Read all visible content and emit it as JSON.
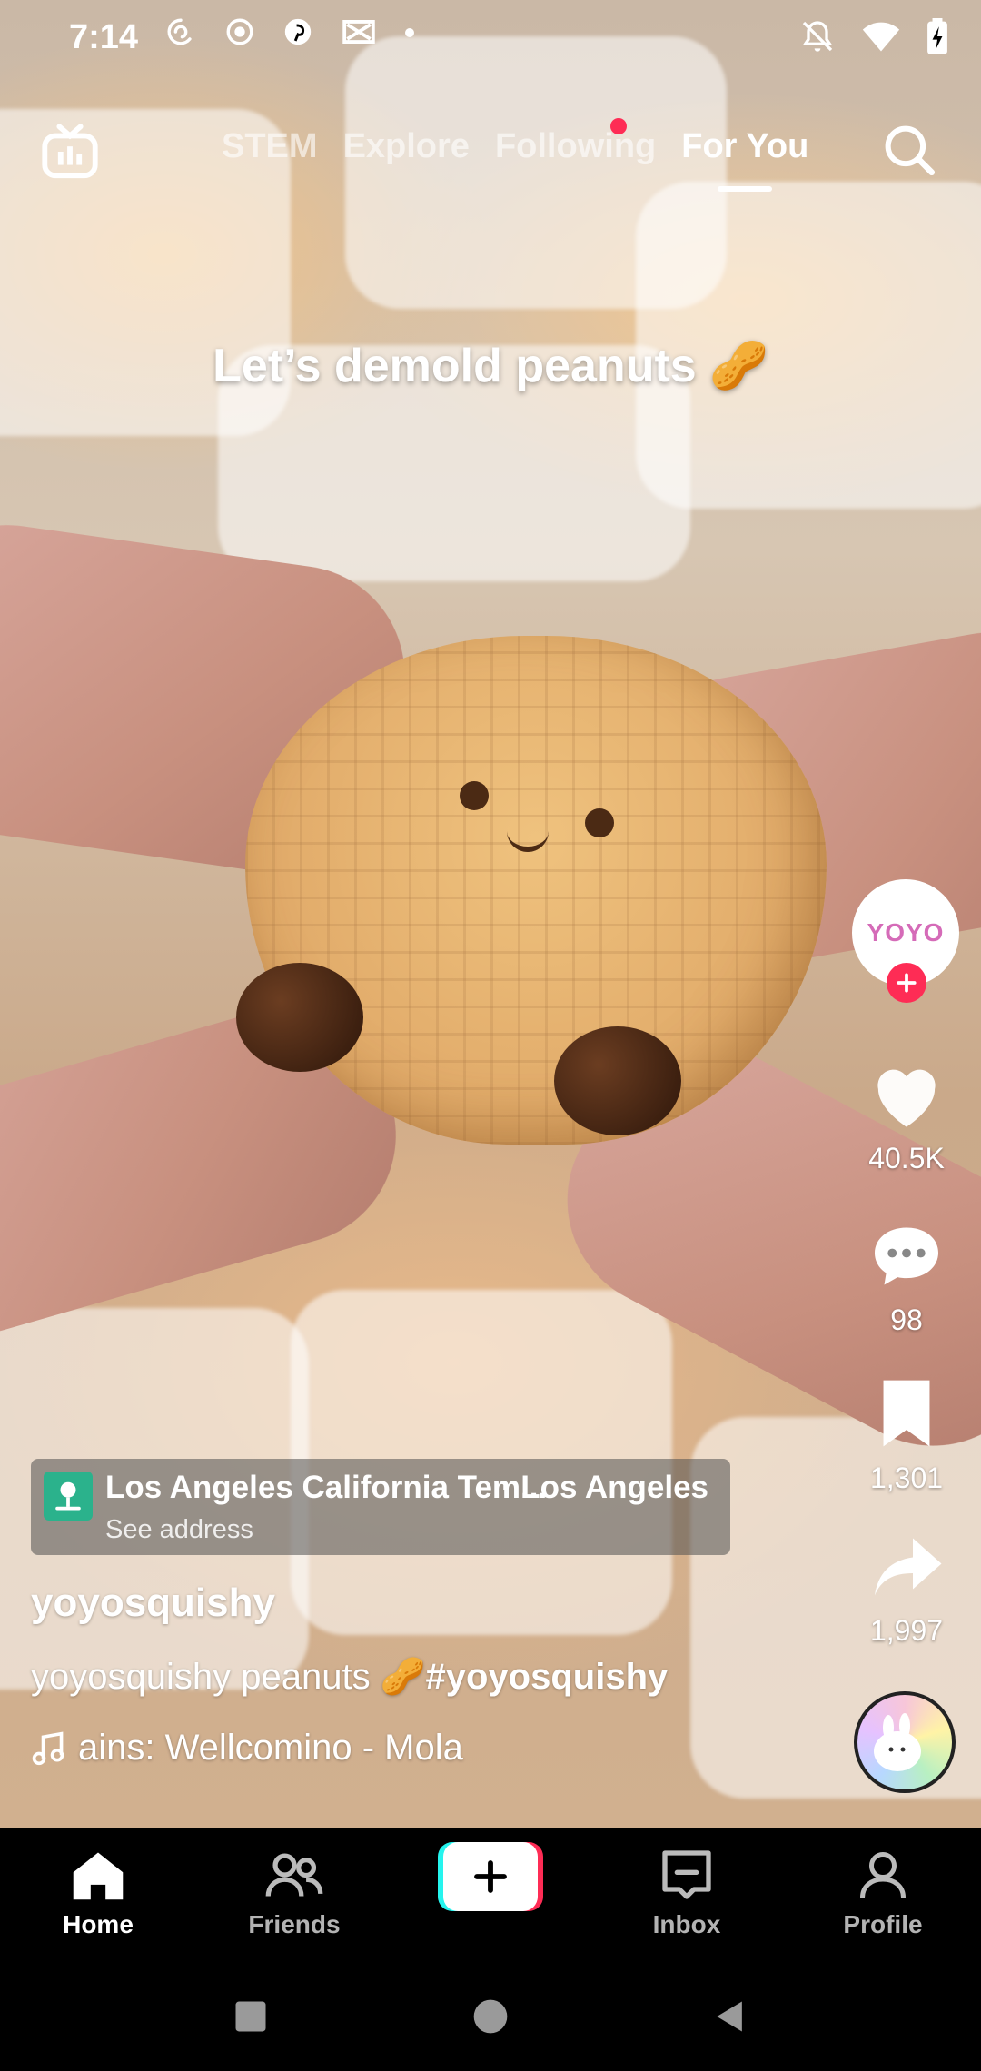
{
  "status_bar": {
    "time": "7:14",
    "left_icons": [
      "threads-icon",
      "record-icon",
      "pinterest-icon",
      "capcut-icon",
      "dot-icon"
    ],
    "right_icons": [
      "do-not-disturb-icon",
      "wifi-icon",
      "battery-charging-icon"
    ]
  },
  "top_nav": {
    "tabs": [
      "STEM",
      "Explore",
      "Following",
      "For You"
    ],
    "active_tab": "For You"
  },
  "video": {
    "caption": "Let’s demold peanuts 🥜"
  },
  "actions": {
    "likes": "40.5K",
    "comments": "98",
    "saves": "1,301",
    "shares": "1,997"
  },
  "location": {
    "name": "Los Angeles California Tem...",
    "city": "· Los Angeles",
    "sub": "See address"
  },
  "post": {
    "username": "yoyosquishy",
    "description": "yoyosquishy peanuts 🥜",
    "hashtag": "#yoyosquishy",
    "music": "ains: Wellcomino - Mola"
  },
  "avatar": {
    "logo_text": "YOYO"
  },
  "bottom_nav": {
    "home": "Home",
    "friends": "Friends",
    "inbox": "Inbox",
    "profile": "Profile"
  },
  "colors": {
    "accent": "#fe2c55",
    "cyan": "#25f4ee",
    "location_icon": "#2bb28c"
  }
}
